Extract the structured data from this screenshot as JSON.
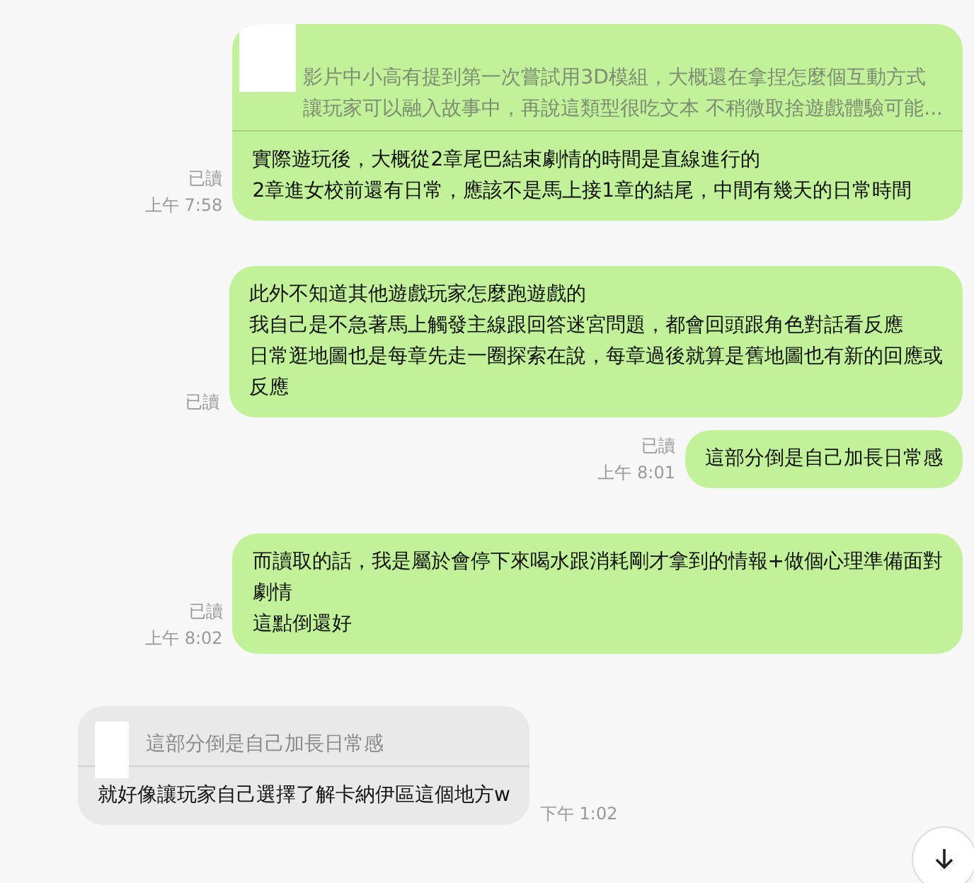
{
  "messages": [
    {
      "kind": "sent",
      "read": "已讀",
      "time": "上午 7:58",
      "quote": {
        "lines": [
          "影片中小高有提到第一次嘗試用3D模組，大概還在拿捏怎麼個互動方式",
          "讓玩家可以融入故事中，再說這類型很吃文本 不稍微取捨遊戲體驗可能..."
        ]
      },
      "lines": [
        "實際遊玩後，大概從2章尾巴結束劇情的時間是直線進行的",
        "2章進女校前還有日常，應該不是馬上接1章的結尾，中間有幾天的日常時間"
      ]
    },
    {
      "kind": "sent",
      "read": "已讀",
      "lines": [
        "此外不知道其他遊戲玩家怎麼跑遊戲的",
        "我自己是不急著馬上觸發主線跟回答迷宮問題，都會回頭跟角色對話看反應",
        "日常逛地圖也是每章先走一圈探索在說，每章過後就算是舊地圖也有新的回應或",
        "反應"
      ]
    },
    {
      "kind": "sent",
      "read": "已讀",
      "time": "上午 8:01",
      "lines": [
        "這部分倒是自己加長日常感"
      ]
    },
    {
      "kind": "sent",
      "read": "已讀",
      "time": "上午 8:02",
      "lines": [
        "而讀取的話，我是屬於會停下來喝水跟消耗剛才拿到的情報+做個心理準備面對",
        "劇情",
        "這點倒還好"
      ]
    },
    {
      "kind": "received",
      "time": "下午 1:02",
      "quote": {
        "lines": [
          "這部分倒是自己加長日常感"
        ]
      },
      "lines": [
        "就好像讓玩家自己選擇了解卡納伊區這個地方w"
      ]
    }
  ]
}
